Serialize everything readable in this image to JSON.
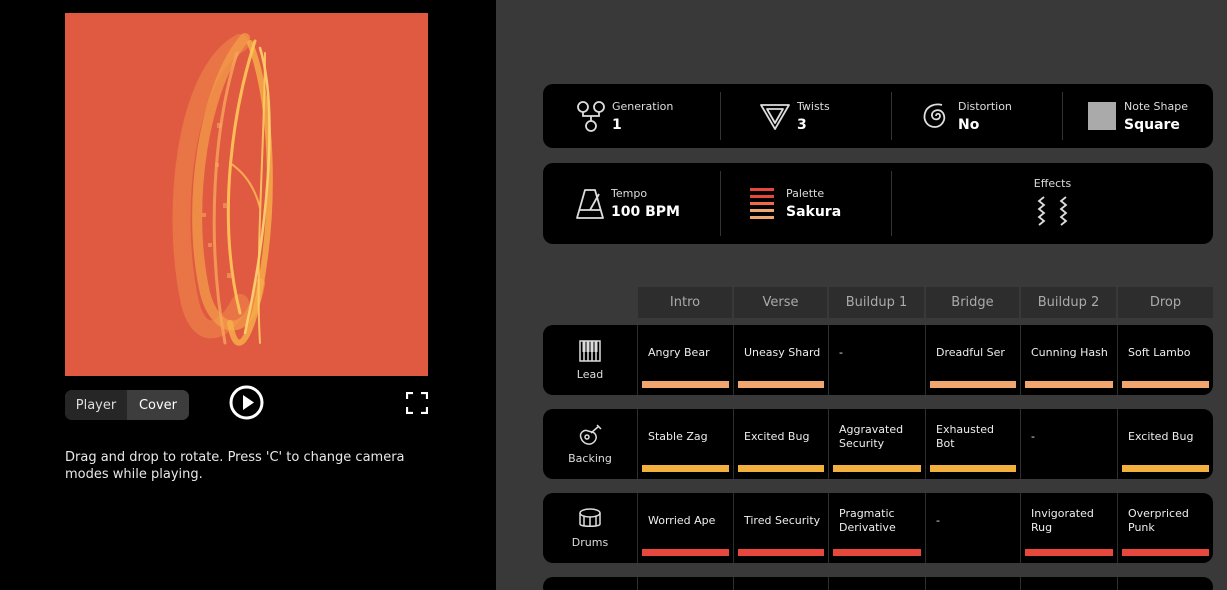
{
  "player": {
    "tabs": [
      "Player",
      "Cover"
    ],
    "hint": "Drag and drop to rotate. Press 'C' to change camera modes while playing.",
    "cover_color": "#e05a42"
  },
  "settings": {
    "generation": {
      "label": "Generation",
      "value": "1"
    },
    "twists": {
      "label": "Twists",
      "value": "3"
    },
    "distortion": {
      "label": "Distortion",
      "value": "No"
    },
    "note_shape": {
      "label": "Note Shape",
      "value": "Square"
    },
    "tempo": {
      "label": "Tempo",
      "value": "100 BPM"
    },
    "palette": {
      "label": "Palette",
      "value": "Sakura"
    },
    "effects": {
      "label": "Effects"
    }
  },
  "sections": [
    "Intro",
    "Verse",
    "Buildup 1",
    "Bridge",
    "Buildup 2",
    "Drop"
  ],
  "tracks": [
    {
      "name": "Lead",
      "icon": "keyboard-icon",
      "bar_color": "#f0a66e",
      "segments": [
        "Angry Bear",
        "Uneasy Shard",
        "-",
        "Dreadful Ser",
        "Cunning Hash",
        "Soft Lambo"
      ],
      "has_bar": [
        true,
        true,
        false,
        true,
        true,
        true
      ]
    },
    {
      "name": "Backing",
      "icon": "guitar-icon",
      "bar_color": "#f2b03e",
      "segments": [
        "Stable Zag",
        "Excited Bug",
        "Aggravated Security",
        "Exhausted Bot",
        "-",
        "Excited Bug"
      ],
      "has_bar": [
        true,
        true,
        true,
        true,
        false,
        true
      ]
    },
    {
      "name": "Drums",
      "icon": "drum-icon",
      "bar_color": "#e8483c",
      "segments": [
        "Worried Ape",
        "Tired Security",
        "Pragmatic Derivative",
        "-",
        "Invigorated Rug",
        "Overpriced Punk"
      ],
      "has_bar": [
        true,
        true,
        true,
        false,
        true,
        true
      ]
    }
  ]
}
